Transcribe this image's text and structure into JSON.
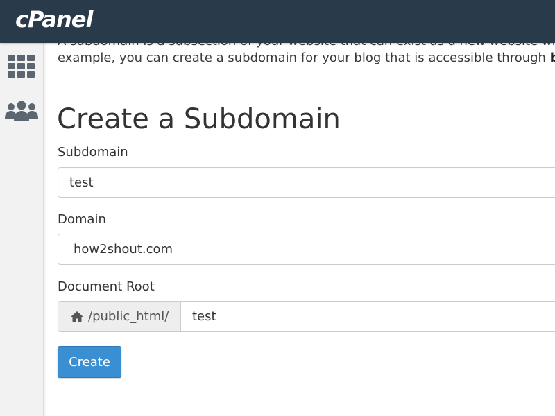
{
  "header": {
    "logo_text": "cPanel",
    "background_color": "#293a4a"
  },
  "sidebar": {
    "items": [
      {
        "icon": "grid-icon"
      },
      {
        "icon": "users-icon"
      }
    ]
  },
  "intro": {
    "line1": "A subdomain is a subsection of your website that can exist as a new website witho",
    "line2_prefix": "example, you can create a subdomain for your blog that is accessible through ",
    "line2_bold": "blog"
  },
  "form": {
    "title": "Create a Subdomain",
    "subdomain_label": "Subdomain",
    "subdomain_value": "test",
    "domain_label": "Domain",
    "domain_value": "how2shout.com",
    "docroot_label": "Document Root",
    "docroot_prefix": "/public_html/",
    "docroot_value": "test",
    "submit_label": "Create",
    "submit_color": "#3a8fd3"
  }
}
